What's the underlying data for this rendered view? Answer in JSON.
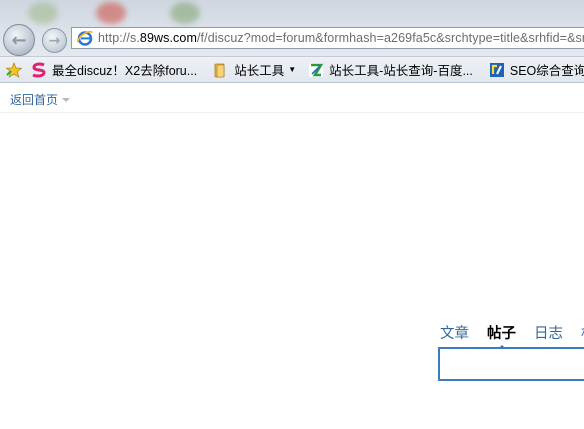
{
  "browser": {
    "address_bar": {
      "url_prefix": "http://s.",
      "url_host": "89ws.com",
      "url_path": "/f/discuz?mod=forum&formhash=a269fa5c&srchtype=title&srhfid=&srhl"
    },
    "favorites": [
      {
        "label": "最全discuz！X2去除foru...",
        "icon": "s-logo-icon"
      },
      {
        "label": "站长工具",
        "icon": "folder-icon",
        "has_dropdown": true
      },
      {
        "label": "站长工具-站长查询-百度...",
        "icon": "chinaz-icon"
      },
      {
        "label": "SEO综合查询 - 站",
        "icon": "seo-icon"
      }
    ]
  },
  "page": {
    "back_home_label": "返回首页",
    "search": {
      "tabs": [
        {
          "label": "文章",
          "active": false
        },
        {
          "label": "帖子",
          "active": true
        },
        {
          "label": "日志",
          "active": false
        },
        {
          "label": "相",
          "active": false
        }
      ],
      "input_value": ""
    }
  },
  "colors": {
    "link": "#336699",
    "active_tab": "#000000",
    "input_border": "#3d7abf"
  }
}
